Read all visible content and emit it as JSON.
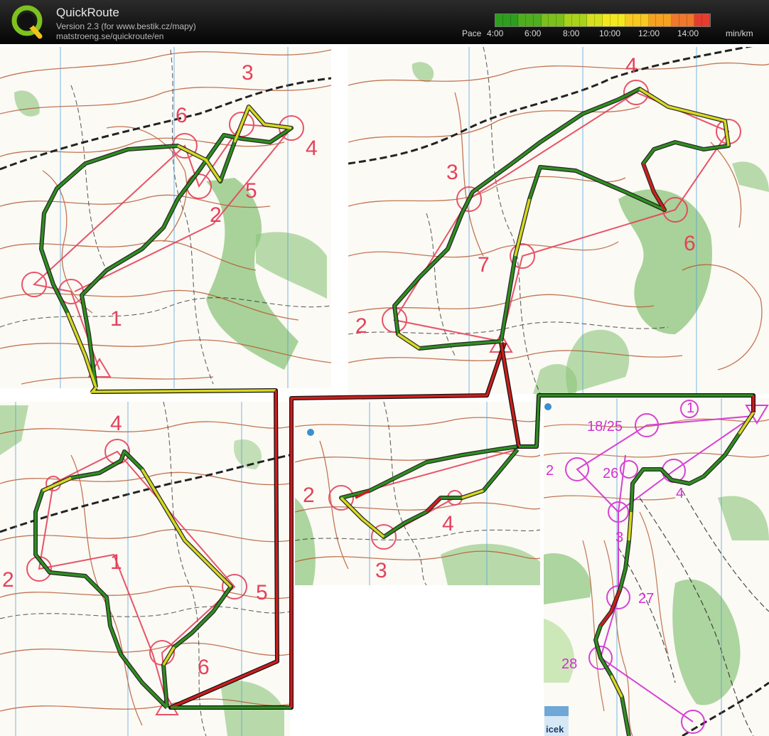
{
  "app": {
    "title": "QuickRoute",
    "version": "Version 2.3  (for www.bestik.cz/mapy)",
    "url": "matstroeng.se/quickroute/en"
  },
  "legend": {
    "label": "Pace",
    "ticks": [
      "4:00",
      "6:00",
      "8:00",
      "10:00",
      "12:00",
      "14:00"
    ],
    "unit": "min/km",
    "colors": [
      "#2e9e1e",
      "#4fae1e",
      "#7cc11a",
      "#a9d31a",
      "#d6e11c",
      "#f3e81d",
      "#f8c81e",
      "#f6a21f",
      "#f0782a",
      "#e63c2e"
    ]
  },
  "map": {
    "colors": {
      "paper": "#fbfaf5",
      "contour": "#b5532b",
      "vegetation": "#8cc47a",
      "course": "#e5415a",
      "course_last": "#d22fd2",
      "route_fast": "#2f8f20",
      "route_medium": "#d8d820",
      "route_slow": "#cc1e1e",
      "water": "#3a8fd0"
    },
    "controls_a": [
      "1",
      "2",
      "3",
      "4",
      "5",
      "6"
    ],
    "controls_b": [
      "2",
      "3",
      "4",
      "6",
      "7"
    ],
    "controls_c": [
      "1",
      "2",
      "4",
      "5",
      "6"
    ],
    "controls_d": [
      "2",
      "3",
      "4"
    ],
    "controls_e": [
      "1",
      "2",
      "3",
      "4",
      "18/25",
      "26",
      "27",
      "28"
    ],
    "fragment_text": "icek"
  }
}
